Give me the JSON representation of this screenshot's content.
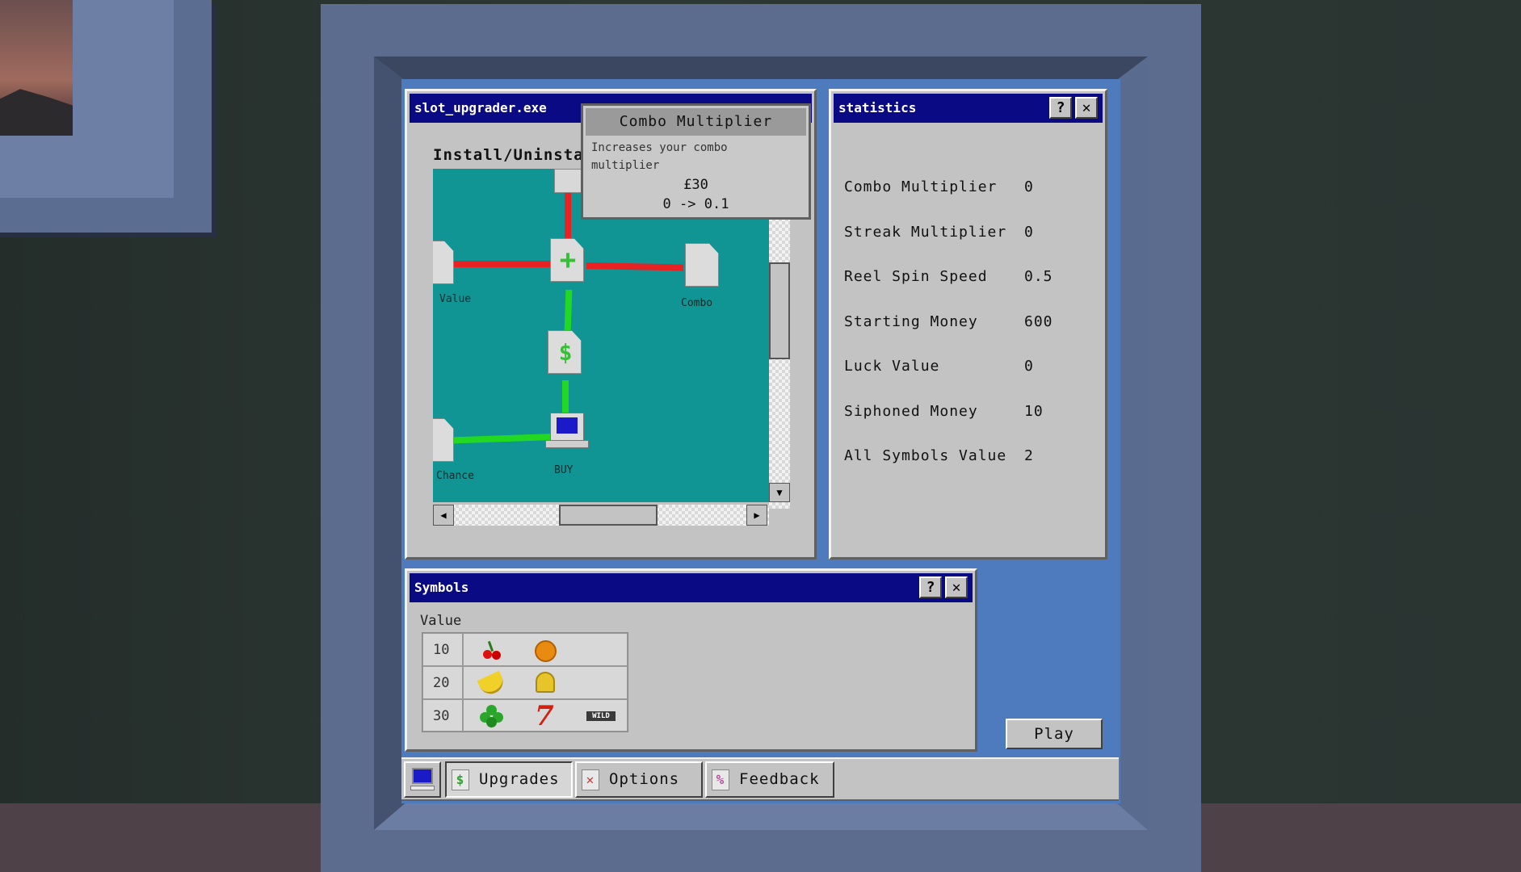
{
  "upgrader": {
    "title": "slot_upgrader.exe",
    "subtitle": "Install/Uninstal",
    "nodes": {
      "value_label": "Value",
      "combo_label": "Combo",
      "chance_label": "Chance",
      "buy_label": "BUY",
      "plus_icon": "+",
      "dollar_icon": "$"
    }
  },
  "tooltip": {
    "title": "Combo Multiplier",
    "description_line1": "Increases your combo",
    "description_line2": "multiplier",
    "price": "£30",
    "change": "0 -> 0.1"
  },
  "statistics": {
    "title": "statistics",
    "help": "?",
    "close": "✕",
    "rows": [
      {
        "label": "Combo Multiplier",
        "value": "0"
      },
      {
        "label": "Streak Multiplier",
        "value": "0"
      },
      {
        "label": "Reel Spin Speed",
        "value": "0.5"
      },
      {
        "label": "Starting Money",
        "value": "600"
      },
      {
        "label": "Luck Value",
        "value": "0"
      },
      {
        "label": "Siphoned Money",
        "value": "10"
      },
      {
        "label": "All Symbols Value",
        "value": "2"
      }
    ]
  },
  "symbols": {
    "title": "Symbols",
    "help": "?",
    "close": "✕",
    "header": "Value",
    "rows": [
      {
        "value": "10",
        "symbols": [
          "cherry-icon",
          "orange-icon"
        ]
      },
      {
        "value": "20",
        "symbols": [
          "banana-icon",
          "bell-icon"
        ]
      },
      {
        "value": "30",
        "symbols": [
          "clover-icon",
          "seven-icon",
          "wild-icon"
        ]
      }
    ],
    "seven": "7",
    "wild": "WILD"
  },
  "play_label": "Play",
  "taskbar": {
    "tabs": [
      {
        "label": "Upgrades",
        "icon": "$"
      },
      {
        "label": "Options",
        "icon": "✕"
      },
      {
        "label": "Feedback",
        "icon": "%"
      }
    ]
  },
  "colors": {
    "titlebar": "#0a0a84",
    "grid": "#119494",
    "red_link": "#e82222",
    "green_link": "#22d822",
    "desktop": "#4d7bbd"
  }
}
